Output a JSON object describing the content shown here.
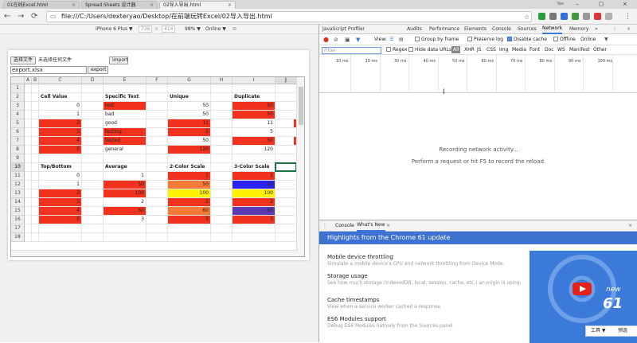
{
  "browser": {
    "tabs": [
      {
        "title": "01在线Excel.html"
      },
      {
        "title": "Spread.Sheets 设计器"
      },
      {
        "title": "02导入导出.html"
      }
    ],
    "user_label": "Yao",
    "url": "file:///C:/Users/dexteryao/Desktop/在前端玩转Excel/02导入导出.html"
  },
  "emulation": {
    "device": "iPhone 6 Plus ▼",
    "width": "736",
    "height": "414",
    "zoom": "98% ▼",
    "network": "Online ▼"
  },
  "page": {
    "choose_file": "选择文件",
    "no_file": "未选择任何文件",
    "import": "import",
    "filename": "export.xlsx",
    "export": "export"
  },
  "spreadsheet": {
    "columns": [
      "A",
      "B",
      "C",
      "D",
      "E",
      "F",
      "G",
      "H",
      "I",
      "J"
    ],
    "rows": [
      "1",
      "2",
      "3",
      "4",
      "5",
      "6",
      "7",
      "8",
      "9",
      "10",
      "11",
      "12",
      "13",
      "14",
      "15",
      "16",
      "17",
      "18"
    ],
    "selected_column": "J",
    "selected_row": "10",
    "headers": {
      "cell_value": "Cell Value",
      "specific_text": "Specific Text",
      "unique": "Unique",
      "duplicate": "Duplicate",
      "top_bottom": "Top/Bottom",
      "average": "Average",
      "two_color": "2-Color Scale",
      "three_color": "3-Color Scale"
    },
    "cell_value_col": [
      "0",
      "1",
      "2",
      "3",
      "4",
      "5"
    ],
    "specific_text_col": [
      "test",
      "bad",
      "good",
      "testing",
      "tested",
      "general"
    ],
    "unique_col": [
      "50",
      "50",
      "11",
      "5",
      "50",
      "120"
    ],
    "duplicate_col": [
      "50",
      "50",
      "11",
      "5",
      "50",
      "120"
    ],
    "top_bottom_col": [
      "0",
      "1",
      "2",
      "3",
      "4",
      "5"
    ],
    "average_col": [
      "1",
      "50",
      "100",
      "2",
      "60",
      "3"
    ],
    "two_color_col": [
      "1",
      "50",
      "100",
      "2",
      "60",
      "3"
    ],
    "three_color_col": [
      "1",
      "50",
      "100",
      "2",
      "60",
      "3"
    ]
  },
  "devtools": {
    "tabs": [
      "JavaScript Profiler",
      "Audits",
      "Performance",
      "Elements",
      "Console",
      "Sources",
      "Network",
      "Memory",
      "»"
    ],
    "active_tab": "Network",
    "toolbar": {
      "view": "View:",
      "group": "Group by frame",
      "preserve": "Preserve log",
      "disable_cache": "Disable cache",
      "offline": "Offline",
      "online": "Online"
    },
    "filter": {
      "placeholder": "Filter",
      "regex": "Regex",
      "hide_data": "Hide data URLs",
      "all": "All",
      "types": [
        "XHR",
        "JS",
        "CSS",
        "Img",
        "Media",
        "Font",
        "Doc",
        "WS",
        "Manifest",
        "Other"
      ]
    },
    "timeline_ticks": [
      "10 ms",
      "20 ms",
      "30 ms",
      "40 ms",
      "50 ms",
      "60 ms",
      "70 ms",
      "80 ms",
      "90 ms",
      "100 ms"
    ],
    "recording": "Recording network activity...",
    "perform_hint": "Perform a request or hit F5 to record the reload.",
    "drawer": {
      "tabs": [
        "Console",
        "What's New"
      ],
      "banner": "Highlights from the Chrome 61 update",
      "items": [
        {
          "title": "Mobile device throttling",
          "desc": "Simulate a mobile device's CPU and network throttling from Device Mode."
        },
        {
          "title": "Storage usage",
          "desc": "See how much storage (IndexedDB, local, session, cache, etc.) an origin is using."
        },
        {
          "title": "Cache timestamps",
          "desc": "View when a service worker cached a response."
        },
        {
          "title": "ES6 Modules support",
          "desc": "Debug ES6 Modules natively from the Sources panel."
        }
      ],
      "promo_new": "new",
      "promo_num": "61",
      "ime_tools": "工具 ▼",
      "ime_preview": "预选"
    }
  },
  "colors": {
    "red": "#f2321e",
    "orange": "#f47a35",
    "yellow": "#fff200",
    "blue": "#2b24ee",
    "purple": "#5a3bb3",
    "accent": "#3879d9"
  }
}
